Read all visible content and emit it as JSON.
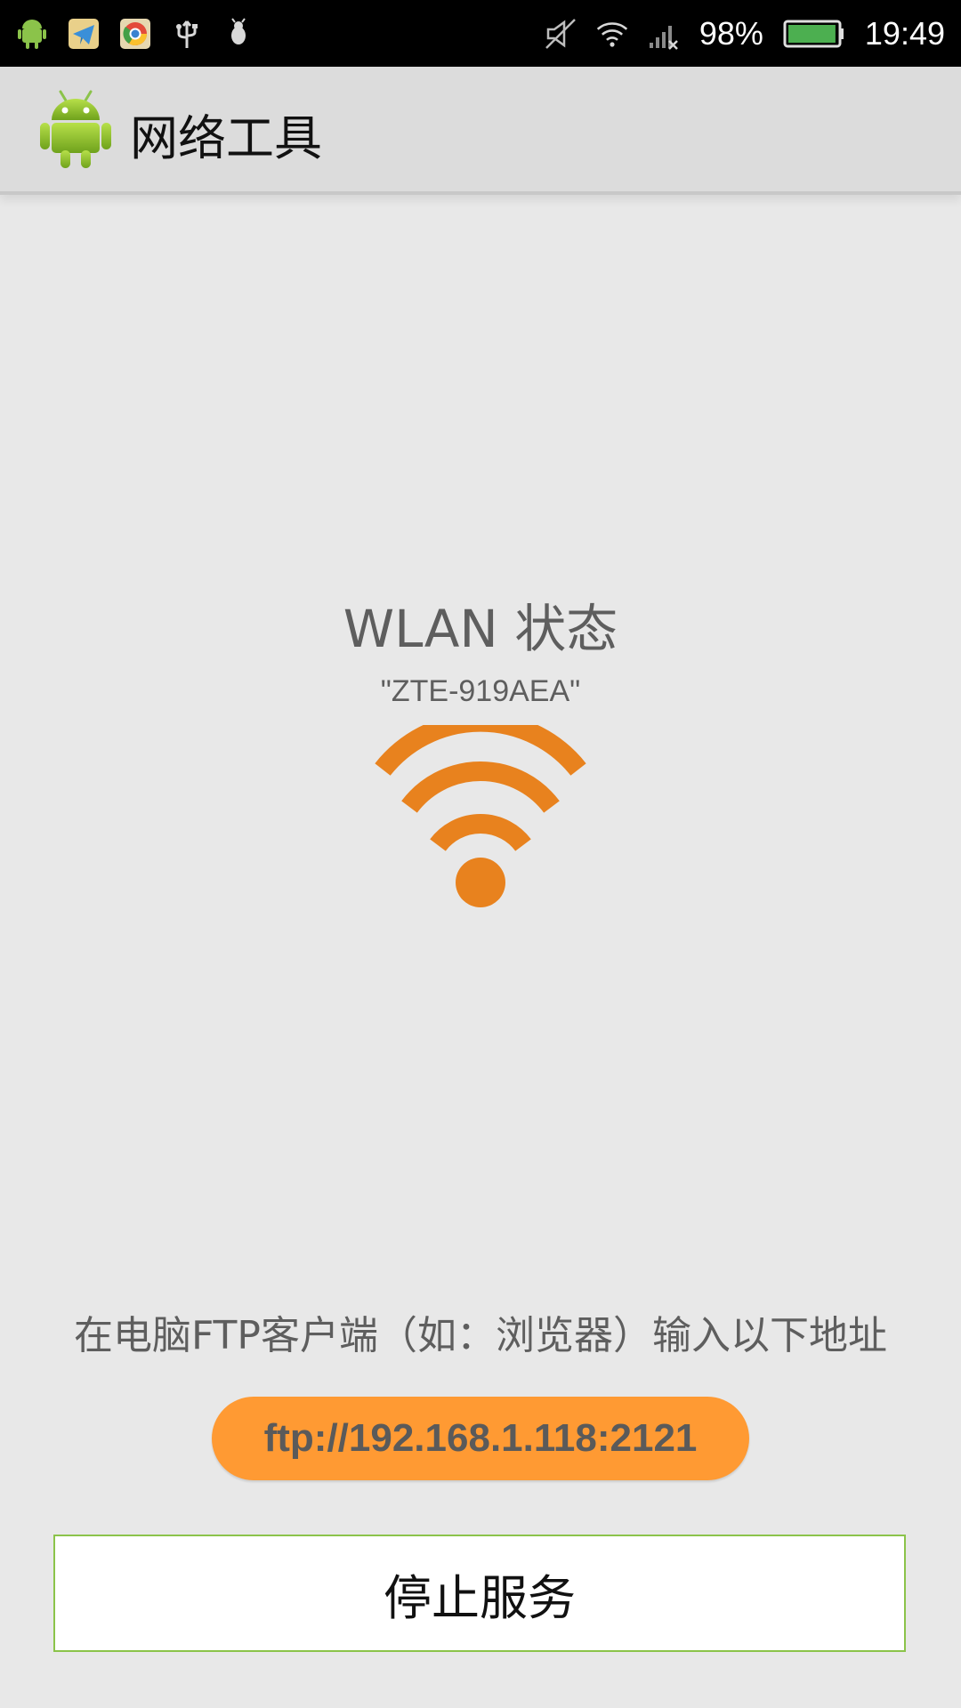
{
  "status_bar": {
    "left_icons": [
      "android-icon",
      "telegram-icon",
      "chrome-icon",
      "usb-icon",
      "debug-bug-icon"
    ],
    "right_icons": [
      "mute-icon",
      "wifi-icon",
      "no-signal-icon",
      "battery-icon"
    ],
    "battery_percent_text": "98%",
    "battery_level": 0.98,
    "time": "19:49"
  },
  "action_bar": {
    "app_icon": "android-robot-icon",
    "title": "网络工具"
  },
  "main": {
    "wlan_status_title": "WLAN 状态",
    "ssid": "\"ZTE-919AEA\"",
    "wifi_icon": "wifi-signal-icon",
    "accent_color": "#e8821e",
    "instruction": "在电脑FTP客户端（如：浏览器）输入以下地址",
    "ftp_address": "ftp://192.168.1.118:2121",
    "ftp_pill_color": "#ff9a33",
    "stop_button_label": "停止服务",
    "stop_button_border_color": "#8bc34a"
  }
}
